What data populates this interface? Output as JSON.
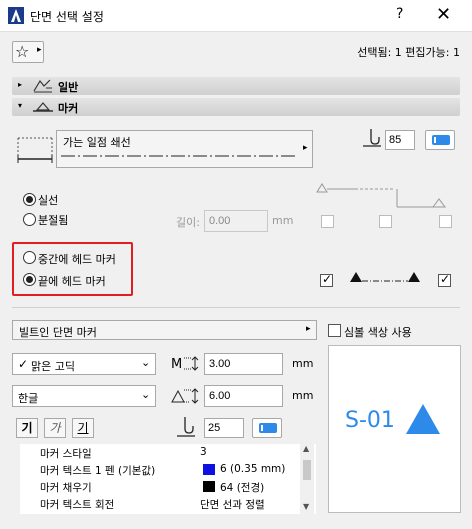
{
  "window": {
    "title": "단면 선택 설정",
    "help_label": "?",
    "close_label": "✕"
  },
  "toolbar": {
    "star_icon": "☆",
    "star_menu": "▸",
    "selection_info": "선택됨: 1 편집가능: 1"
  },
  "sections": {
    "general": {
      "arrow": "▸",
      "label": "일반"
    },
    "marker": {
      "arrow": "▾",
      "label": "마커"
    }
  },
  "line": {
    "linetype_label": "가는 일점 쇄선",
    "pen_value": "85"
  },
  "linestyle": {
    "solid_label": "실선",
    "solid_selected": true,
    "segmented_label": "분절됨",
    "segmented_selected": false,
    "length_label": "길이:",
    "length_value": "0.00",
    "length_unit": "mm"
  },
  "marker_position": {
    "middle_label": "중간에 헤드 마커",
    "middle_selected": false,
    "end_label": "끝에 헤드 마커",
    "end_selected": true
  },
  "marker_type": {
    "label": "빌트인 단면 마커",
    "arrow": "▸",
    "symbol_color_label": "심볼 색상 사용"
  },
  "font": {
    "face_check": "✓",
    "face_value": "맑은 고딕",
    "size_value": "3.00",
    "size_unit": "mm",
    "script_value": "한글",
    "offset_value": "6.00",
    "offset_unit": "mm",
    "bold_label": "기",
    "italic_label": "가",
    "underline_label": "기",
    "pen_value": "25"
  },
  "properties": [
    {
      "key": "마커 스타일",
      "value": "3",
      "swatch": ""
    },
    {
      "key": "마커 텍스트 1 펜 (기본값)",
      "value": "6 (0.35 mm)",
      "swatch": "#1010e0"
    },
    {
      "key": "마커 채우기",
      "value": "64 (전경)",
      "swatch": "#000000"
    },
    {
      "key": "마커 텍스트 회전",
      "value": "단면 선과 정렬",
      "swatch": ""
    }
  ],
  "preview": {
    "label": "S-01",
    "accent_color": "#2d8ae8"
  }
}
